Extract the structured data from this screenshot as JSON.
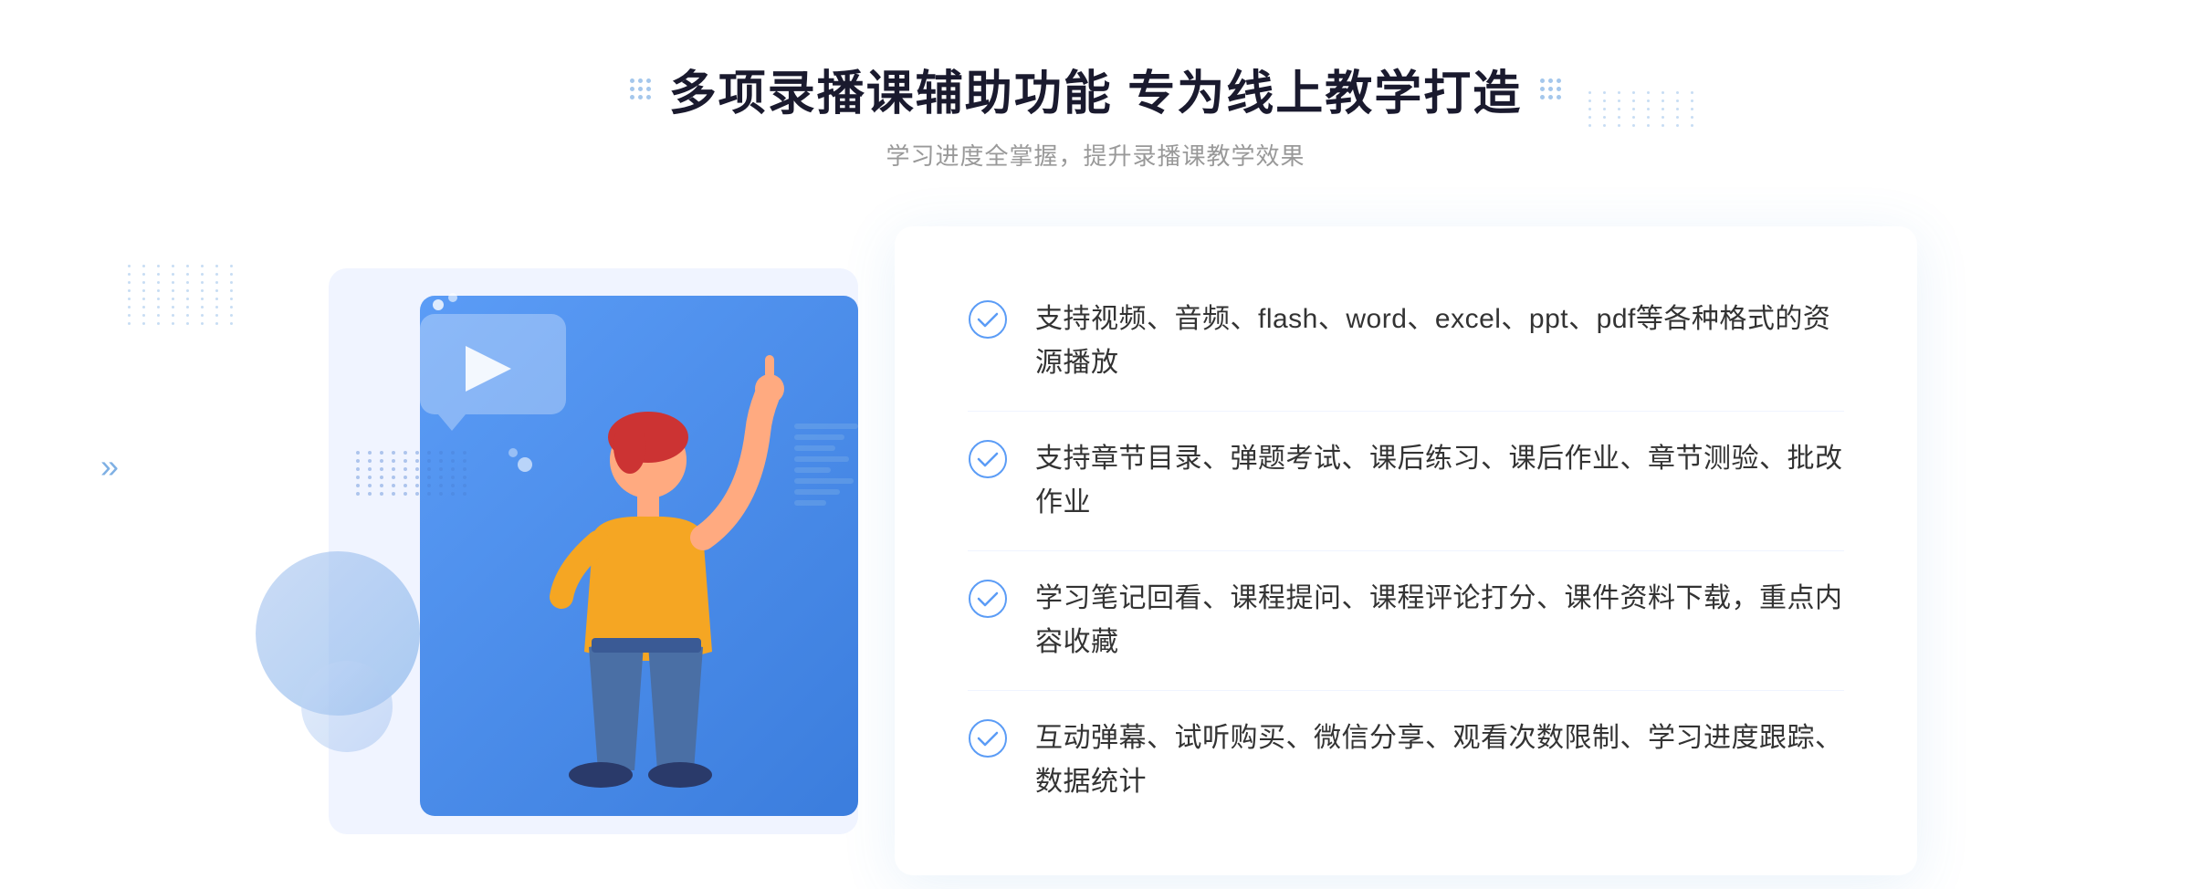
{
  "page": {
    "background": "#ffffff"
  },
  "header": {
    "title": "多项录播课辅助功能 专为线上教学打造",
    "subtitle": "学习进度全掌握，提升录播课教学效果",
    "dots_left_label": "decoration-dots-left",
    "dots_right_label": "decoration-dots-right"
  },
  "features": [
    {
      "id": 1,
      "text": "支持视频、音频、flash、word、excel、ppt、pdf等各种格式的资源播放"
    },
    {
      "id": 2,
      "text": "支持章节目录、弹题考试、课后练习、课后作业、章节测验、批改作业"
    },
    {
      "id": 3,
      "text": "学习笔记回看、课程提问、课程评论打分、课件资料下载，重点内容收藏"
    },
    {
      "id": 4,
      "text": "互动弹幕、试听购买、微信分享、观看次数限制、学习进度跟踪、数据统计"
    }
  ],
  "illustration": {
    "play_button": "▶",
    "chevron": "»"
  }
}
